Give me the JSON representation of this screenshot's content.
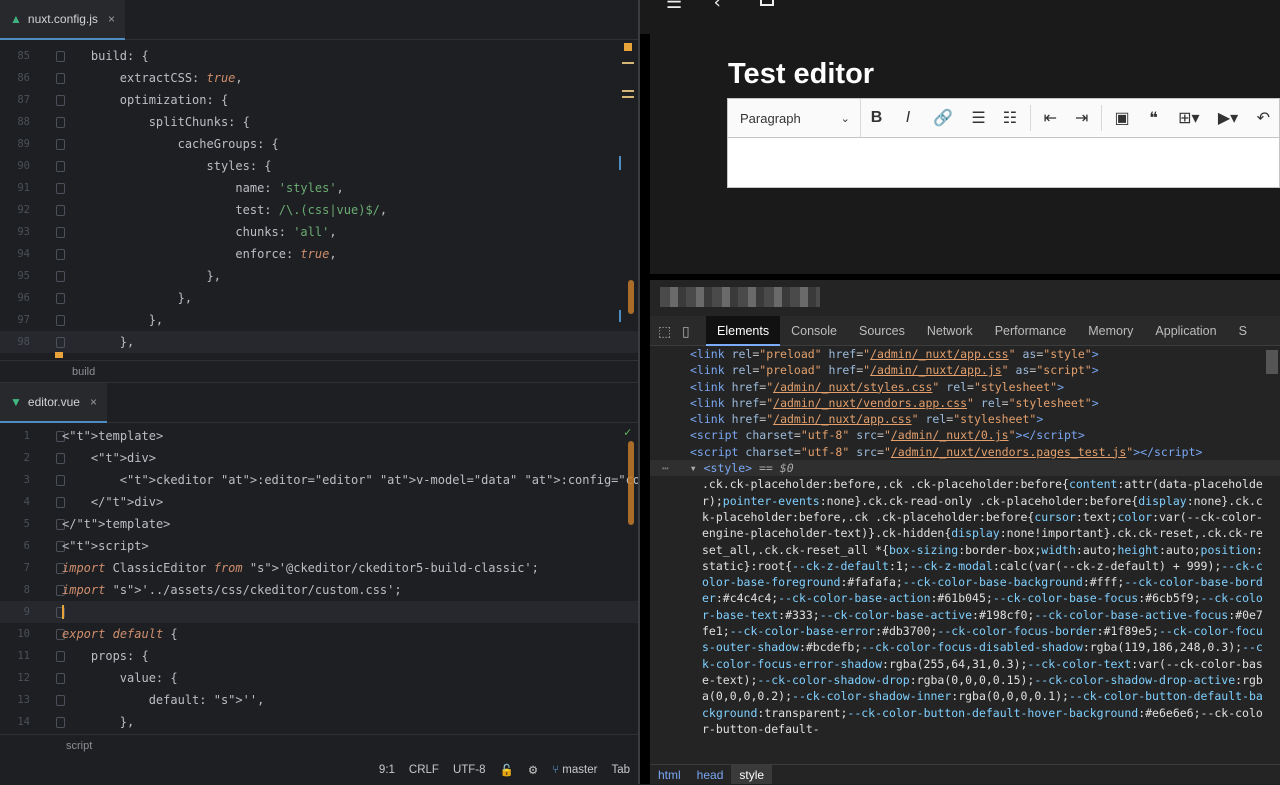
{
  "ide": {
    "top_tab": {
      "label": "nuxt.config.js",
      "close": "×"
    },
    "top_breadcrumb": "build",
    "top_lines": [
      {
        "n": "85",
        "html": "    build: {"
      },
      {
        "n": "86",
        "html": "        extractCSS: true,"
      },
      {
        "n": "87",
        "html": "        optimization: {"
      },
      {
        "n": "88",
        "html": "            splitChunks: {"
      },
      {
        "n": "89",
        "html": "                cacheGroups: {"
      },
      {
        "n": "90",
        "html": "                    styles: {"
      },
      {
        "n": "91",
        "html": "                        name: 'styles',"
      },
      {
        "n": "92",
        "html": "                        test: /\\.(css|vue)$/,"
      },
      {
        "n": "93",
        "html": "                        chunks: 'all',"
      },
      {
        "n": "94",
        "html": "                        enforce: true,"
      },
      {
        "n": "95",
        "html": "                    },"
      },
      {
        "n": "96",
        "html": "                },"
      },
      {
        "n": "97",
        "html": "            },"
      },
      {
        "n": "98",
        "html": "        },"
      }
    ],
    "bottom_tab": {
      "label": "editor.vue",
      "close": "×"
    },
    "bottom_breadcrumb": "script",
    "bottom_lines": [
      {
        "n": "1",
        "html": "<template>"
      },
      {
        "n": "2",
        "html": "    <div>"
      },
      {
        "n": "3",
        "html": "        <ckeditor :editor=\"editor\" v-model=\"data\" :config=\"config\"></ckeditor>"
      },
      {
        "n": "4",
        "html": "    </div>"
      },
      {
        "n": "5",
        "html": "</template>"
      },
      {
        "n": "6",
        "html": "<script>"
      },
      {
        "n": "7",
        "html": "import ClassicEditor from '@ckeditor/ckeditor5-build-classic';"
      },
      {
        "n": "8",
        "html": "import '../assets/css/ckeditor/custom.css';"
      },
      {
        "n": "9",
        "html": ""
      },
      {
        "n": "10",
        "html": "export default {"
      },
      {
        "n": "11",
        "html": "    props: {"
      },
      {
        "n": "12",
        "html": "        value: {"
      },
      {
        "n": "13",
        "html": "            default: '',"
      },
      {
        "n": "14",
        "html": "        },"
      }
    ],
    "status": {
      "position": "9:1",
      "line_sep": "CRLF",
      "encoding": "UTF-8",
      "branch": "master",
      "indent": "Tab"
    }
  },
  "browser": {
    "heading": "Test editor",
    "toolbar": {
      "heading_select": "Paragraph",
      "buttons": [
        {
          "name": "bold-button",
          "glyph": "B"
        },
        {
          "name": "italic-button",
          "glyph": "I"
        },
        {
          "name": "link-button",
          "glyph": "🔗"
        },
        {
          "name": "bulleted-list-button",
          "glyph": "☰"
        },
        {
          "name": "numbered-list-button",
          "glyph": "☷"
        },
        {
          "name": "outdent-button",
          "glyph": "⇤"
        },
        {
          "name": "indent-button",
          "glyph": "⇥"
        },
        {
          "name": "image-button",
          "glyph": "▣"
        },
        {
          "name": "quote-button",
          "glyph": "❝"
        },
        {
          "name": "table-button",
          "glyph": "⊞▾"
        },
        {
          "name": "media-button",
          "glyph": "▶▾"
        },
        {
          "name": "undo-button",
          "glyph": "↶"
        }
      ]
    },
    "devtools": {
      "tabs": [
        "Elements",
        "Console",
        "Sources",
        "Network",
        "Performance",
        "Memory",
        "Application",
        "S"
      ],
      "active_tab": "Elements",
      "head_lines": [
        [
          "link",
          "rel=\"preload\"",
          "/admin/_nuxt/app.css",
          "as=\"style\""
        ],
        [
          "link",
          "rel=\"preload\"",
          "/admin/_nuxt/app.js",
          "as=\"script\""
        ],
        [
          "link",
          "",
          "/admin/_nuxt/styles.css",
          "rel=\"stylesheet\""
        ],
        [
          "link",
          "",
          "/admin/_nuxt/vendors.app.css",
          "rel=\"stylesheet\""
        ],
        [
          "link",
          "",
          "/admin/_nuxt/app.css",
          "rel=\"stylesheet\""
        ]
      ],
      "script_lines": [
        "/admin/_nuxt/0.js",
        "/admin/_nuxt/vendors.pages_test.js"
      ],
      "style_line": "<style> == $0",
      "css_text": ".ck.ck-placeholder:before,.ck .ck-placeholder:before{content:attr(data-placeholder);pointer-events:none}.ck.ck-read-only .ck-placeholder:before{display:none}.ck.ck-placeholder:before,.ck .ck-placeholder:before{cursor:text;color:var(--ck-color-engine-placeholder-text)}.ck-hidden{display:none!important}.ck.ck-reset,.ck.ck-reset_all,.ck.ck-reset_all *{box-sizing:border-box;width:auto;height:auto;position:static}:root{--ck-z-default:1;--ck-z-modal:calc(var(--ck-z-default) + 999);--ck-color-base-foreground:#fafafa;--ck-color-base-background:#fff;--ck-color-base-border:#c4c4c4;--ck-color-base-action:#61b045;--ck-color-base-focus:#6cb5f9;--ck-color-base-text:#333;--ck-color-base-active:#198cf0;--ck-color-base-active-focus:#0e7fe1;--ck-color-base-error:#db3700;--ck-color-focus-border:#1f89e5;--ck-color-focus-outer-shadow:#bcdefb;--ck-color-focus-disabled-shadow:rgba(119,186,248,0.3);--ck-color-focus-error-shadow:rgba(255,64,31,0.3);--ck-color-text:var(--ck-color-base-text);--ck-color-shadow-drop:rgba(0,0,0,0.15);--ck-color-shadow-drop-active:rgba(0,0,0,0.2);--ck-color-shadow-inner:rgba(0,0,0,0.1);--ck-color-button-default-background:transparent;--ck-color-button-default-hover-background:#e6e6e6;--ck-color-button-default-",
      "crumbs": [
        "html",
        "head",
        "style"
      ]
    }
  }
}
